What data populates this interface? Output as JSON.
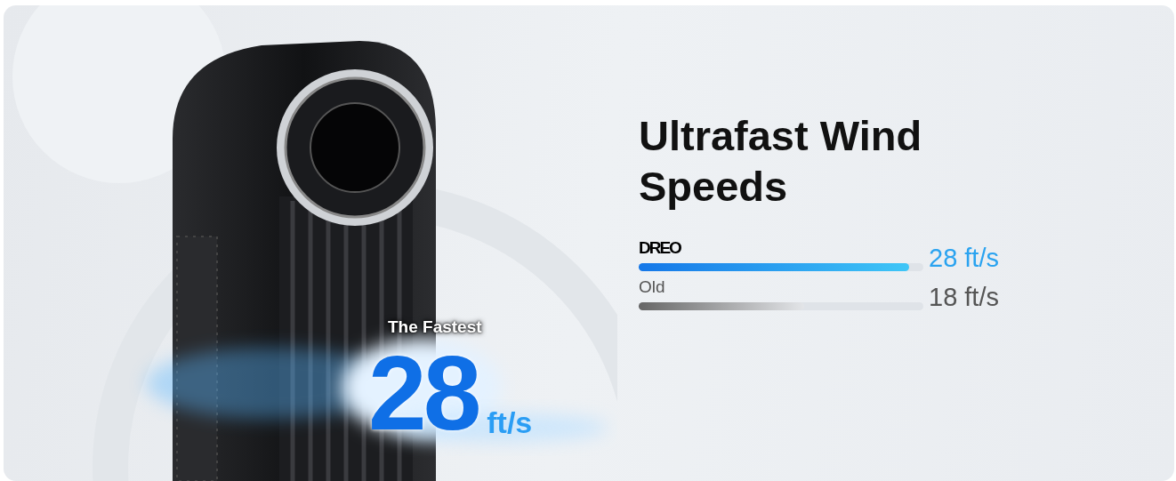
{
  "callout": {
    "label": "The Fastest",
    "value": "28",
    "unit": "ft/s"
  },
  "headline": "Ultrafast Wind Speeds",
  "comparison": [
    {
      "label": "DREO",
      "kind": "brand",
      "level": 0.95,
      "reading": "28 ft/s"
    },
    {
      "label": "Old",
      "kind": "plain",
      "level": 0.58,
      "reading": "18 ft/s"
    }
  ]
}
